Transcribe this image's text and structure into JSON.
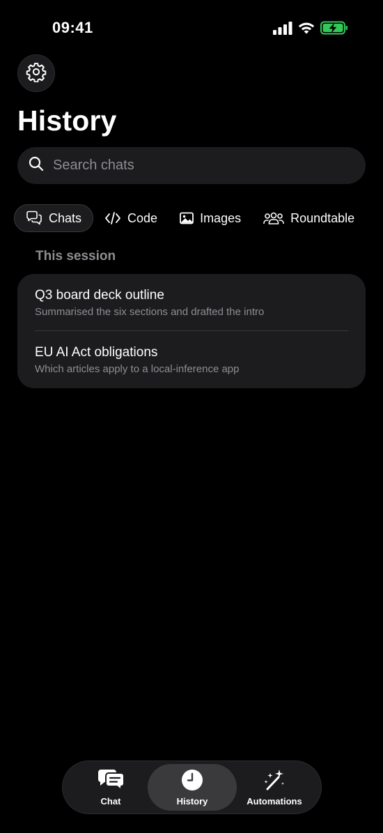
{
  "status_bar": {
    "time": "09:41"
  },
  "header": {
    "title": "History"
  },
  "search": {
    "placeholder": "Search chats",
    "value": ""
  },
  "tabs": [
    {
      "label": "Chats",
      "icon": "chat-bubbles-icon",
      "active": true
    },
    {
      "label": "Code",
      "icon": "code-icon",
      "active": false
    },
    {
      "label": "Images",
      "icon": "image-icon",
      "active": false
    },
    {
      "label": "Roundtable",
      "icon": "people-icon",
      "active": false
    }
  ],
  "section": {
    "label": "This session",
    "items": [
      {
        "title": "Q3 board deck outline",
        "subtitle": "Summarised the six sections and drafted the intro"
      },
      {
        "title": "EU AI Act obligations",
        "subtitle": "Which articles apply to a local-inference app"
      }
    ]
  },
  "bottom_nav": [
    {
      "label": "Chat",
      "icon": "chat-icon",
      "active": false
    },
    {
      "label": "History",
      "icon": "clock-icon",
      "active": true
    },
    {
      "label": "Automations",
      "icon": "magic-wand-icon",
      "active": false
    }
  ],
  "colors": {
    "background": "#000000",
    "surface": "#1c1c1e",
    "secondary_text": "#8e8e93",
    "battery_green": "#34c759"
  }
}
